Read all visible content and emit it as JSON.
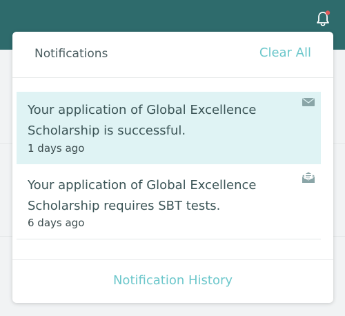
{
  "colors": {
    "topbar": "#2e6b6c",
    "accent": "#6cc7cb",
    "unread_bg": "#dff3f4",
    "bell_badge": "#e05a5a"
  },
  "header": {
    "bell_icon": "bell-icon",
    "has_badge": true
  },
  "notifications_panel": {
    "title": "Notifications",
    "clear_all_label": "Clear All",
    "items": [
      {
        "text": "Your application of Global Excellence Scholarship is successful.",
        "time": "1 days ago",
        "state": "unread",
        "icon": "envelope-closed-icon"
      },
      {
        "text": "Your application of Global Excellence Scholarship requires SBT tests.",
        "time": "6 days ago",
        "state": "read",
        "icon": "envelope-open-icon"
      }
    ],
    "history_link_label": "Notification History"
  }
}
